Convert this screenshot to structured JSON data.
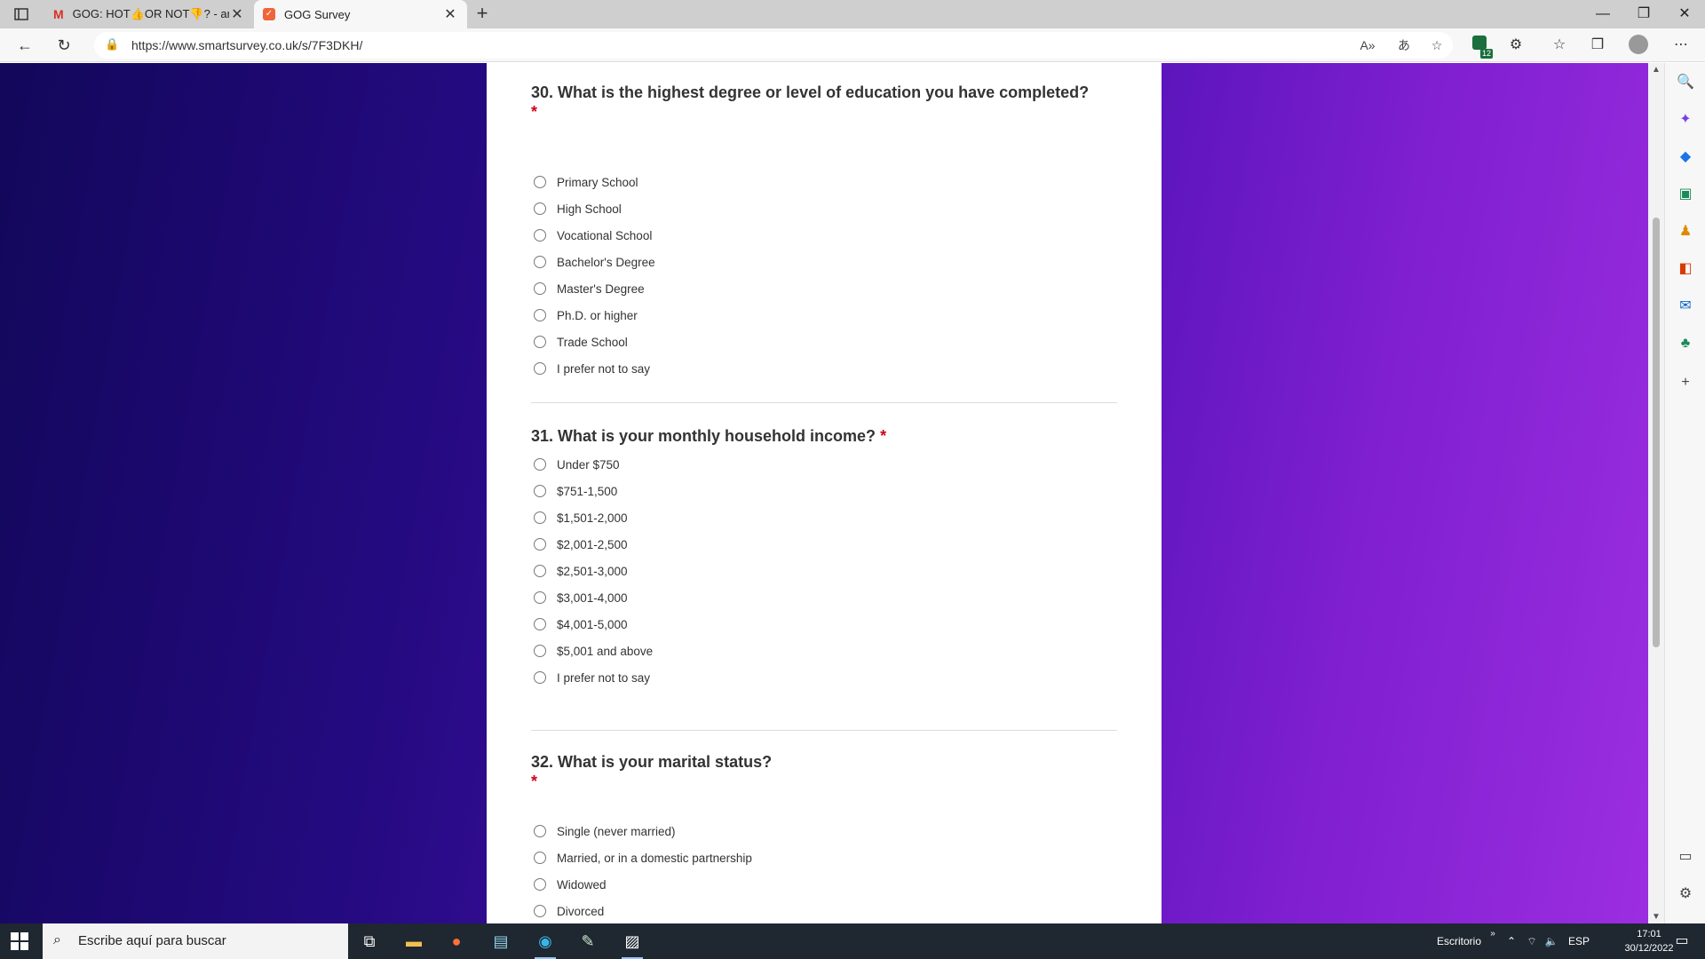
{
  "browser": {
    "tabs": [
      {
        "title": "GOG: HOT👍OR NOT👎? - arruabarrenagabriel@gmail.com",
        "active": false,
        "icon": "gmail-icon"
      },
      {
        "title": "GOG Survey",
        "active": true,
        "icon": "smartsurvey-icon"
      }
    ],
    "url": "https://www.smartsurvey.co.uk/s/7F3DKH/",
    "extensions_badge": "12"
  },
  "survey": {
    "q30": {
      "title": "30. What is the highest degree or level of education you have completed?",
      "required_mark": "*",
      "options": [
        "Primary School",
        "High School",
        "Vocational School",
        "Bachelor's Degree",
        "Master's Degree",
        "Ph.D. or higher",
        "Trade School",
        "I prefer not to say"
      ]
    },
    "q31": {
      "title": "31. What is your monthly household income?",
      "required_mark": "*",
      "options": [
        "Under $750",
        "$751-1,500",
        "$1,501-2,000",
        "$2,001-2,500",
        "$2,501-3,000",
        "$3,001-4,000",
        "$4,001-5,000",
        "$5,001 and above",
        "I prefer not to say"
      ]
    },
    "q32": {
      "title": "32. What is your marital status?",
      "required_mark": "*",
      "options": [
        "Single (never married)",
        "Married, or in a domestic partnership",
        "Widowed",
        "Divorced"
      ]
    }
  },
  "taskbar": {
    "search_placeholder": "Escribe aquí para buscar",
    "desktop_label": "Escritorio",
    "language": "ESP",
    "time": "17:01",
    "date": "30/12/2022"
  },
  "colors": {
    "required": "#d0021b",
    "bg_left": "#12075a",
    "bg_right": "#9b2ee0"
  }
}
